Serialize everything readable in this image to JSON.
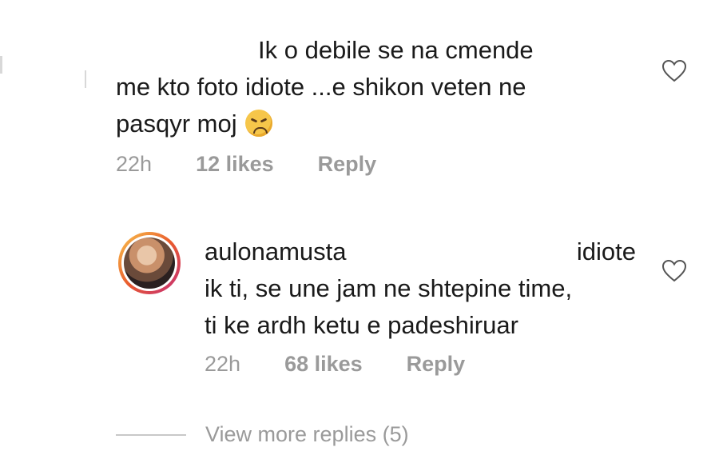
{
  "comment1": {
    "lines": [
      "Ik o debile se na cmende",
      "me kto foto idiote ...e shikon veten ne",
      "pasqyr moj"
    ],
    "emoji": "weary-face-icon",
    "time": "22h",
    "likes": "12 likes",
    "reply": "Reply"
  },
  "comment2": {
    "username": "aulonamusta",
    "first_word": "idiote",
    "lines": [
      "ik ti, se une jam ne shtepine time,",
      "ti ke ardh ketu e padeshiruar"
    ],
    "time": "22h",
    "likes": "68 likes",
    "reply": "Reply"
  },
  "view_more": "View more replies (5)",
  "colors": {
    "text": "#1a1a1a",
    "meta": "#9a9a9a",
    "ring_start": "#f9c54d",
    "ring_end": "#c32c7a"
  }
}
